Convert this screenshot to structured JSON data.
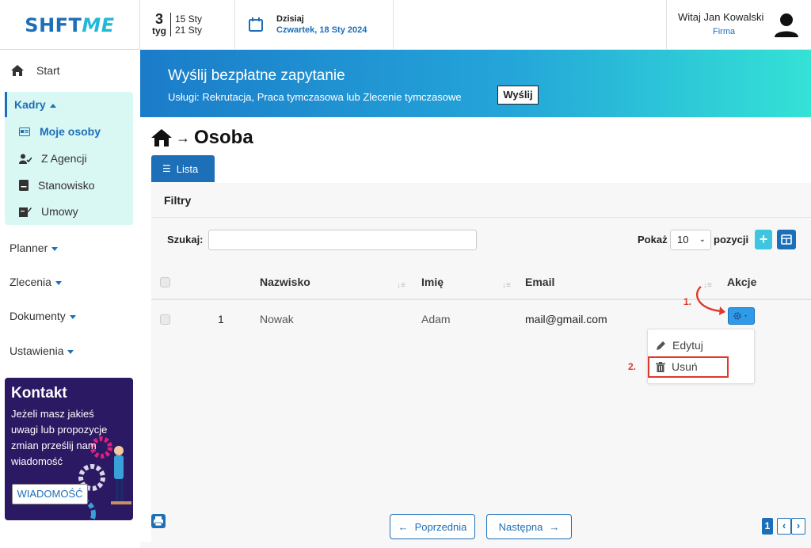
{
  "logo": {
    "part1": "SHFT",
    "part2": "ME"
  },
  "week": {
    "number": "3",
    "label": "tyg",
    "from": "15 Sty",
    "to": "21 Sty"
  },
  "today": {
    "title": "Dzisiaj",
    "date": "Czwartek, 18 Sty 2024"
  },
  "user": {
    "greeting": "Witaj Jan Kowalski",
    "company": "Firma"
  },
  "sidebar": {
    "start": "Start",
    "kadry": "Kadry",
    "kadry_items": [
      "Moje osoby",
      "Z Agencji",
      "Stanowisko",
      "Umowy"
    ],
    "planner": "Planner",
    "zlecenia": "Zlecenia",
    "dokumenty": "Dokumenty",
    "ustawienia": "Ustawienia"
  },
  "contact": {
    "title": "Kontakt",
    "text": "Jeżeli masz jakieś uwagi lub propozycje zmian prześlij nam wiadomość",
    "button": "WIADOMOŚĆ"
  },
  "banner": {
    "title": "Wyślij bezpłatne zapytanie",
    "subtitle": "Usługi: Rekrutacja, Praca tymczasowa lub Zlecenie tymczasowe",
    "button": "Wyślij"
  },
  "breadcrumb": {
    "page": "Osoba"
  },
  "tab": {
    "label": "Lista"
  },
  "filters": {
    "title": "Filtry",
    "search_label": "Szukaj:",
    "search_value": "",
    "show_label": "Pokaż",
    "show_value": "10",
    "positions_label": "pozycji"
  },
  "table": {
    "columns": [
      "Nazwisko",
      "Imię",
      "Email",
      "Akcje"
    ],
    "rows": [
      {
        "no": "1",
        "surname": "Nowak",
        "name": "Adam",
        "email": "mail@gmail.com"
      }
    ]
  },
  "actions_menu": {
    "edit": "Edytuj",
    "delete": "Usuń"
  },
  "steps": {
    "one": "1.",
    "two": "2."
  },
  "pagination": {
    "prev": "Poprzednia",
    "next": "Następna",
    "current": "1"
  },
  "colors": {
    "primary": "#1d6fb8",
    "accent": "#3ec6e0",
    "highlight": "#e0392b",
    "sidebar_active_bg": "#d9f7f3",
    "contact_bg": "#2b1963"
  }
}
